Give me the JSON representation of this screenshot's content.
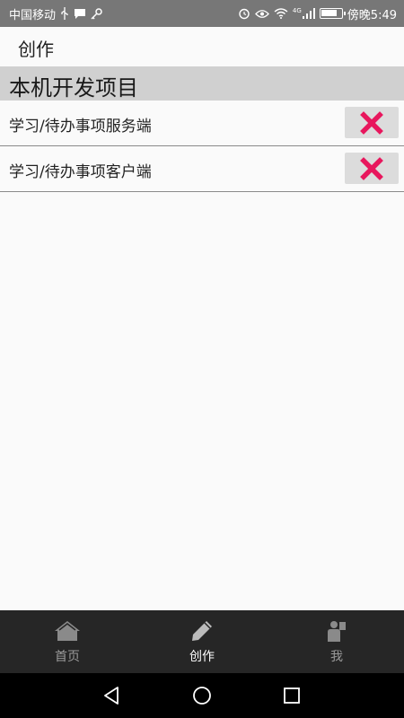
{
  "status_bar": {
    "carrier": "中国移动",
    "right_text": "傍晚5:49",
    "network_label": "4G",
    "battery_level": 0.8,
    "icons": [
      "usb-icon",
      "message-icon",
      "key-icon",
      "alarm-icon",
      "eye-icon",
      "wifi-icon",
      "signal-icon",
      "battery-icon"
    ]
  },
  "app_bar": {
    "title": "创作"
  },
  "section": {
    "title": "本机开发项目"
  },
  "projects": [
    {
      "name": "学习/待办事项服务端"
    },
    {
      "name": "学习/待办事项客户端"
    }
  ],
  "bottom_nav": {
    "items": [
      {
        "label": "首页",
        "icon": "home-icon"
      },
      {
        "label": "创作",
        "icon": "pencil-icon",
        "active": true
      },
      {
        "label": "我",
        "icon": "person-icon"
      }
    ]
  },
  "colors": {
    "delete_accent": "#e8175d",
    "status_bar": "#777777",
    "section_header": "#d0d0d0",
    "bottom_nav": "#262626",
    "nav_icon_inactive": "#8a8a8a",
    "nav_icon_active": "#bbbbbb"
  }
}
